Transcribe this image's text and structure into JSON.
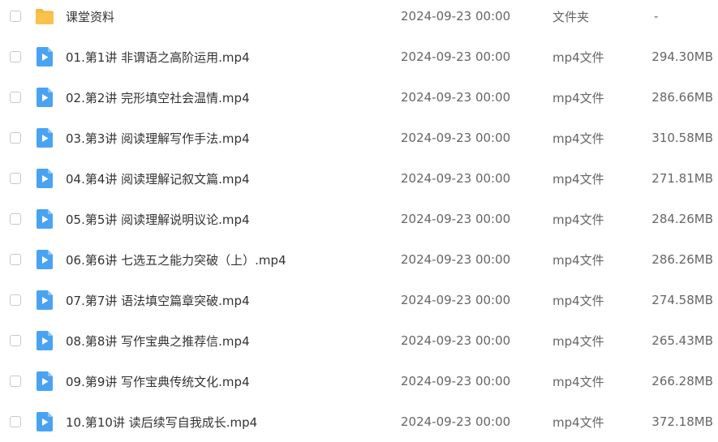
{
  "colors": {
    "folder": "#F9C24A",
    "video": "#4AA3F2",
    "text_primary": "#333333",
    "text_secondary": "#666666",
    "checkbox_border": "#C8C8C8"
  },
  "files": [
    {
      "name": "课堂资料",
      "date": "2024-09-23 00:00",
      "type": "文件夹",
      "size": "-",
      "icon": "folder-icon"
    },
    {
      "name": "01.第1讲 非谓语之高阶运用.mp4",
      "date": "2024-09-23 00:00",
      "type": "mp4文件",
      "size": "294.30MB",
      "icon": "video-file-icon"
    },
    {
      "name": "02.第2讲 完形填空社会温情.mp4",
      "date": "2024-09-23 00:00",
      "type": "mp4文件",
      "size": "286.66MB",
      "icon": "video-file-icon"
    },
    {
      "name": "03.第3讲 阅读理解写作手法.mp4",
      "date": "2024-09-23 00:00",
      "type": "mp4文件",
      "size": "310.58MB",
      "icon": "video-file-icon"
    },
    {
      "name": "04.第4讲 阅读理解记叙文篇.mp4",
      "date": "2024-09-23 00:00",
      "type": "mp4文件",
      "size": "271.81MB",
      "icon": "video-file-icon"
    },
    {
      "name": "05.第5讲 阅读理解说明议论.mp4",
      "date": "2024-09-23 00:00",
      "type": "mp4文件",
      "size": "284.26MB",
      "icon": "video-file-icon"
    },
    {
      "name": "06.第6讲 七选五之能力突破（上）.mp4",
      "date": "2024-09-23 00:00",
      "type": "mp4文件",
      "size": "286.26MB",
      "icon": "video-file-icon"
    },
    {
      "name": "07.第7讲 语法填空篇章突破.mp4",
      "date": "2024-09-23 00:00",
      "type": "mp4文件",
      "size": "274.58MB",
      "icon": "video-file-icon"
    },
    {
      "name": "08.第8讲 写作宝典之推荐信.mp4",
      "date": "2024-09-23 00:00",
      "type": "mp4文件",
      "size": "265.43MB",
      "icon": "video-file-icon"
    },
    {
      "name": "09.第9讲 写作宝典传统文化.mp4",
      "date": "2024-09-23 00:00",
      "type": "mp4文件",
      "size": "266.28MB",
      "icon": "video-file-icon"
    },
    {
      "name": "10.第10讲 读后续写自我成长.mp4",
      "date": "2024-09-23 00:00",
      "type": "mp4文件",
      "size": "372.18MB",
      "icon": "video-file-icon"
    }
  ]
}
